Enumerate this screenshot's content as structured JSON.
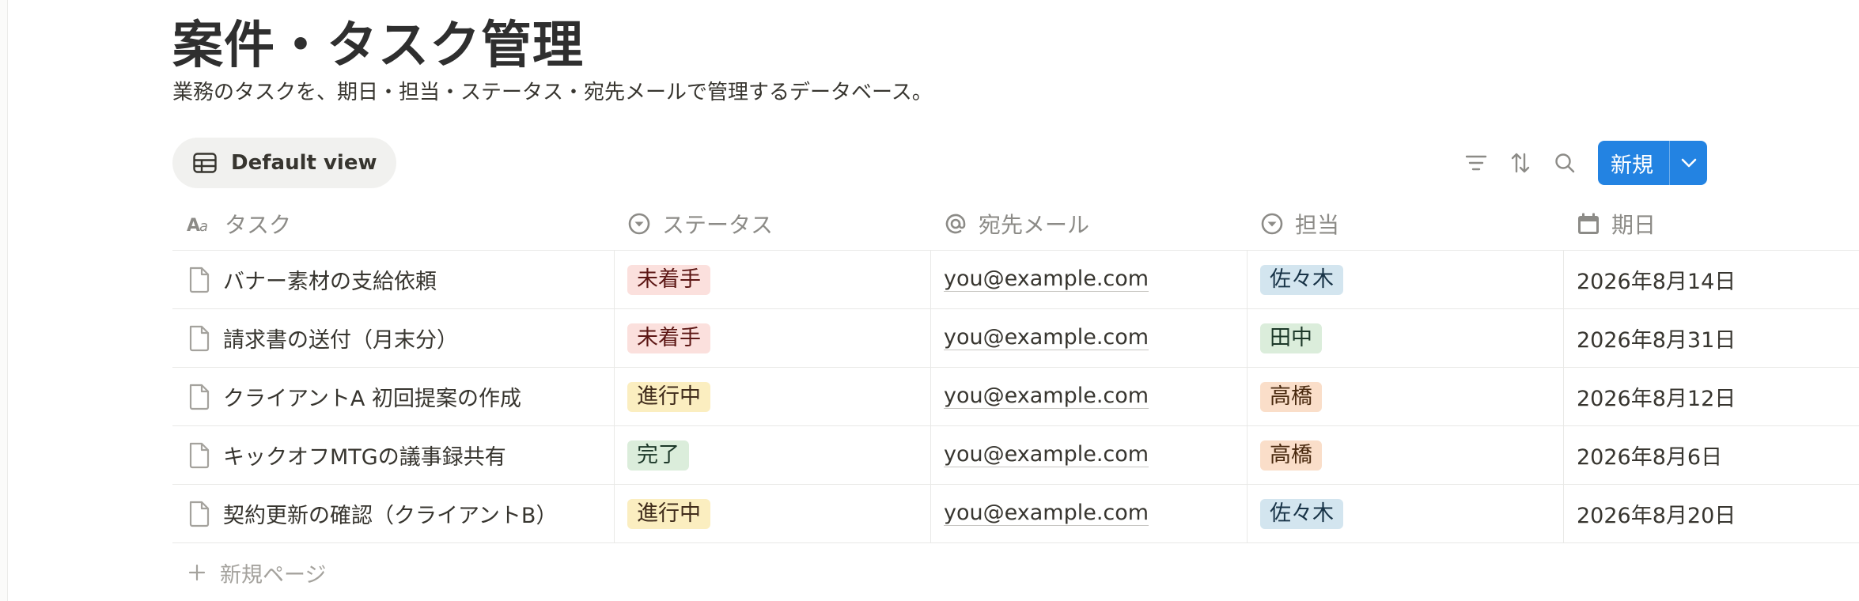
{
  "page": {
    "title": "案件・タスク管理",
    "description": "業務のタスクを、期日・担当・ステータス・宛先メールで管理するデータベース。"
  },
  "view": {
    "label": "Default view",
    "icon": "table-icon"
  },
  "toolbar": {
    "filter_icon": "filter-icon",
    "sort_icon": "sort-icon",
    "search_icon": "search-icon",
    "new_label": "新規",
    "new_dropdown_icon": "chevron-down-icon",
    "accent": "#2383e2"
  },
  "columns": [
    {
      "label": "タスク",
      "icon": "text-property-icon"
    },
    {
      "label": "ステータス",
      "icon": "select-property-icon"
    },
    {
      "label": "宛先メール",
      "icon": "at-icon"
    },
    {
      "label": "担当",
      "icon": "select-property-icon"
    },
    {
      "label": "期日",
      "icon": "calendar-icon"
    }
  ],
  "rows": [
    {
      "task": "バナー素材の支給依頼",
      "status": "未着手",
      "email": "you@example.com",
      "owner": "佐々木",
      "due": "2026年8月14日"
    },
    {
      "task": "請求書の送付（月末分）",
      "status": "未着手",
      "email": "you@example.com",
      "owner": "田中",
      "due": "2026年8月31日"
    },
    {
      "task": "クライアントA 初回提案の作成",
      "status": "進行中",
      "email": "you@example.com",
      "owner": "高橋",
      "due": "2026年8月12日"
    },
    {
      "task": "キックオフMTGの議事録共有",
      "status": "完了",
      "email": "you@example.com",
      "owner": "高橋",
      "due": "2026年8月6日"
    },
    {
      "task": "契約更新の確認（クライアントB）",
      "status": "進行中",
      "email": "you@example.com",
      "owner": "佐々木",
      "due": "2026年8月20日"
    }
  ],
  "tag_colors": {
    "未着手": {
      "bg": "#fbe0dd",
      "fg": "#5d1715"
    },
    "進行中": {
      "bg": "#fbeec0",
      "fg": "#402c1b"
    },
    "完了": {
      "bg": "#dbeddb",
      "fg": "#1c3829"
    },
    "佐々木": {
      "bg": "#d3e5ef",
      "fg": "#183347"
    },
    "田中": {
      "bg": "#dbeddb",
      "fg": "#1c3829"
    },
    "高橋": {
      "bg": "#fadec9",
      "fg": "#49290e"
    }
  },
  "add_row": {
    "label": "新規ページ",
    "icon": "plus-icon"
  }
}
